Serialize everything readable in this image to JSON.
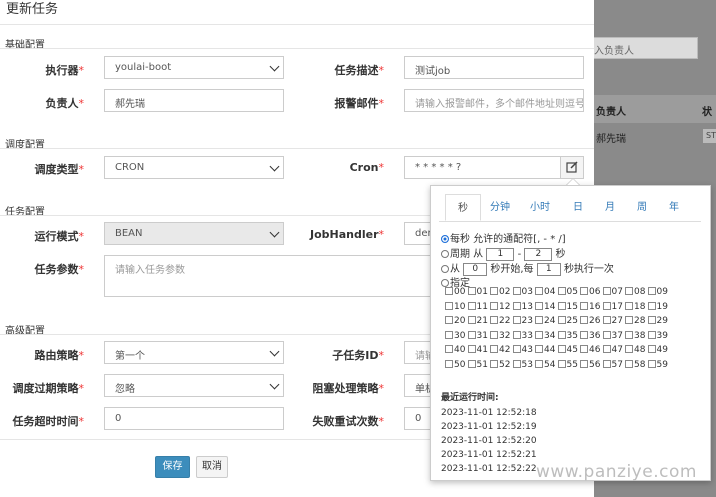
{
  "background": {
    "search_placeholder": "入负责人",
    "table_headers": [
      "负责人",
      "状"
    ],
    "row_owner": "郝先瑞",
    "row_badge": "ST"
  },
  "watermark": "www.panziye.com",
  "modal": {
    "title": "更新任务",
    "sections": {
      "basic": "基础配置",
      "schedule": "调度配置",
      "task": "任务配置",
      "advanced": "高级配置"
    },
    "fields": {
      "executor": {
        "label": "执行器",
        "value": "youlai-boot"
      },
      "desc": {
        "label": "任务描述",
        "value": "测试job"
      },
      "owner": {
        "label": "负责人",
        "value": "郝先瑞"
      },
      "alarm_email": {
        "label": "报警邮件",
        "placeholder": "请输入报警邮件，多个邮件地址则逗号分隔"
      },
      "schedule_type": {
        "label": "调度类型",
        "value": "CRON"
      },
      "cron": {
        "label": "Cron",
        "value": "* * * * * ?"
      },
      "run_mode": {
        "label": "运行模式",
        "value": "BEAN"
      },
      "job_handler": {
        "label": "JobHandler",
        "value": "dem"
      },
      "task_param": {
        "label": "任务参数",
        "placeholder": "请输入任务参数"
      },
      "route": {
        "label": "路由策略",
        "value": "第一个"
      },
      "child_id": {
        "label": "子任务ID",
        "placeholder": "请输"
      },
      "misfire": {
        "label": "调度过期策略",
        "value": "忽略"
      },
      "block": {
        "label": "阻塞处理策略",
        "value": "单机"
      },
      "timeout": {
        "label": "任务超时时间",
        "value": "0"
      },
      "retry": {
        "label": "失败重试次数",
        "value": "0"
      }
    },
    "save_label": "保存",
    "cancel_label": "取消"
  },
  "cron_popup": {
    "tabs": [
      "秒",
      "分钟",
      "小时",
      "日",
      "月",
      "周",
      "年"
    ],
    "active_tab": "秒",
    "options": {
      "every": "每秒 允许的通配符[, - * /]",
      "period_prefix": "周期 从",
      "period_from": "1",
      "period_dash": "-",
      "period_to": "2",
      "period_suffix": "秒",
      "from_prefix": "从",
      "from_start": "0",
      "from_mid": "秒开始,每",
      "from_step": "1",
      "from_suffix": "秒执行一次",
      "specify": "指定"
    },
    "seconds": [
      "00",
      "01",
      "02",
      "03",
      "04",
      "05",
      "06",
      "07",
      "08",
      "09",
      "10",
      "11",
      "12",
      "13",
      "14",
      "15",
      "16",
      "17",
      "18",
      "19",
      "20",
      "21",
      "22",
      "23",
      "24",
      "25",
      "26",
      "27",
      "28",
      "29",
      "30",
      "31",
      "32",
      "33",
      "34",
      "35",
      "36",
      "37",
      "38",
      "39",
      "40",
      "41",
      "42",
      "43",
      "44",
      "45",
      "46",
      "47",
      "48",
      "49",
      "50",
      "51",
      "52",
      "53",
      "54",
      "55",
      "56",
      "57",
      "58",
      "59"
    ],
    "recent_title": "最近运行时间:",
    "recent_times": [
      "2023-11-01 12:52:18",
      "2023-11-01 12:52:19",
      "2023-11-01 12:52:20",
      "2023-11-01 12:52:21",
      "2023-11-01 12:52:22"
    ]
  }
}
